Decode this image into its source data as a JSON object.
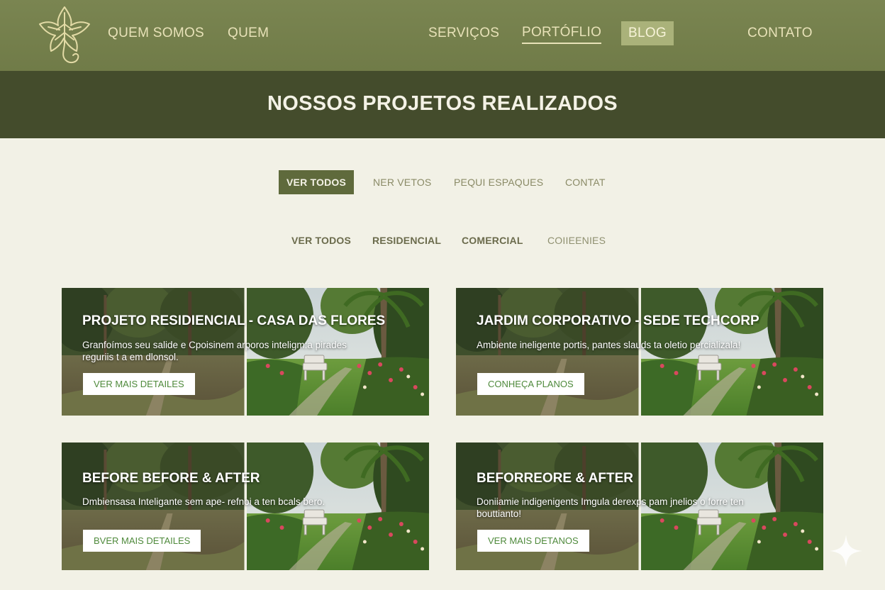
{
  "nav": {
    "items": [
      {
        "label": "QUEM SOMOS"
      },
      {
        "label": "QUEM"
      },
      {
        "label": "SERVIÇOS"
      },
      {
        "label": "PORTÓFLIO"
      },
      {
        "label": "BLOG"
      },
      {
        "label": "CONTATO"
      }
    ]
  },
  "page": {
    "title": "NOSSOS PROJETOS REALIZADOS"
  },
  "filters_primary": [
    {
      "label": "VER TODOS",
      "active": true
    },
    {
      "label": "NER VETOS"
    },
    {
      "label": "PEQUI ESPAQUES"
    },
    {
      "label": "CONTAT"
    }
  ],
  "filters_secondary": [
    {
      "label": "VER TODOS"
    },
    {
      "label": "RESIDENCIAL"
    },
    {
      "label": "COMERCIAL"
    },
    {
      "label": "COIIEENIES"
    }
  ],
  "projects": [
    {
      "title": "PROJETO RESIDIENCIAL - CASA DAS FLORES",
      "description": "Granfoímos seu salide e Cpoisinem arporos inteligm:a pirades reguriis t a em dlonsol.",
      "button": "VER MAIS DETAILES"
    },
    {
      "title": "JARDIM CORPORATIVO - SEDE TECHCORP",
      "description": "Ambiente ineligente portis, pantes slauds ta oletio percializala!",
      "button": "CONHEÇA PLANOS"
    },
    {
      "title": "BEFORE BEFORE & AFTER",
      "description": "Dmbiensasa Inteligante sem ape- refnoi a ten bcals bero.",
      "button": "BVER MAIS DETAILES"
    },
    {
      "title": "BEFORREORE & AFTER",
      "description": "Doniiamie indigenigents Imgula derexps pam jnelios o forre ten bouttianto!",
      "button": "VER MAIS DETANOS"
    }
  ],
  "colors": {
    "nav_bg": "#737e4a",
    "title_band": "#444c2c",
    "accent_button": "#5f6a3c",
    "page_bg": "#f2f1e6",
    "nav_text": "#e8e2b8"
  },
  "icons": [
    "leaf-logo-icon",
    "sparkle-icon"
  ]
}
